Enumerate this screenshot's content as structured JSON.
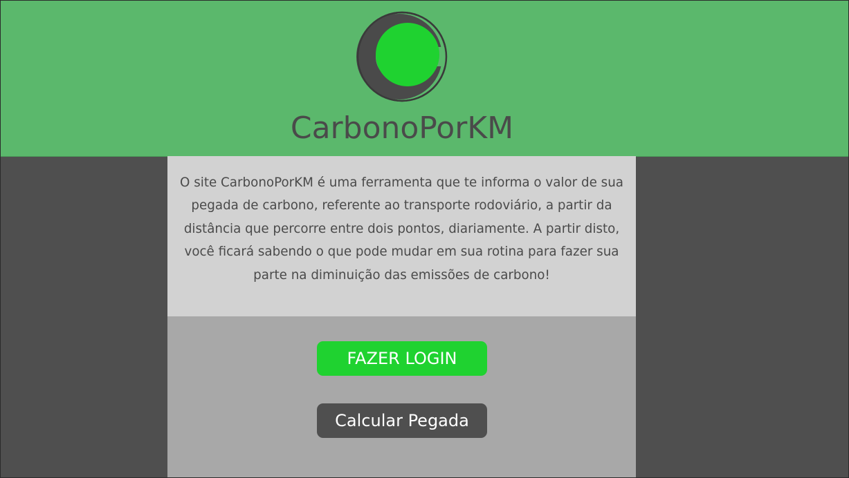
{
  "brand": {
    "title": "CarbonoPorKM",
    "logo_icon": "carbon-c-logo-icon",
    "logo_letter": "C"
  },
  "description": {
    "text": "O site CarbonoPorKM é uma ferramenta que te informa o valor de sua pegada de carbono, referente ao transporte rodoviário, a partir da distância que percorre entre dois pontos, diariamente. A partir disto, você ficará sabendo o que pode mudar em sua rotina para fazer sua parte na diminuição das emissões de carbono!"
  },
  "actions": {
    "login_label": "FAZER LOGIN",
    "calculate_label": "Calcular Pegada"
  },
  "colors": {
    "header_bg": "#5bb86c",
    "page_bg": "#4f4f4f",
    "description_bg": "#d2d2d2",
    "panel_bg": "#a8a8a8",
    "accent_green": "#1fd230",
    "dark_gray": "#4a4a4a"
  }
}
